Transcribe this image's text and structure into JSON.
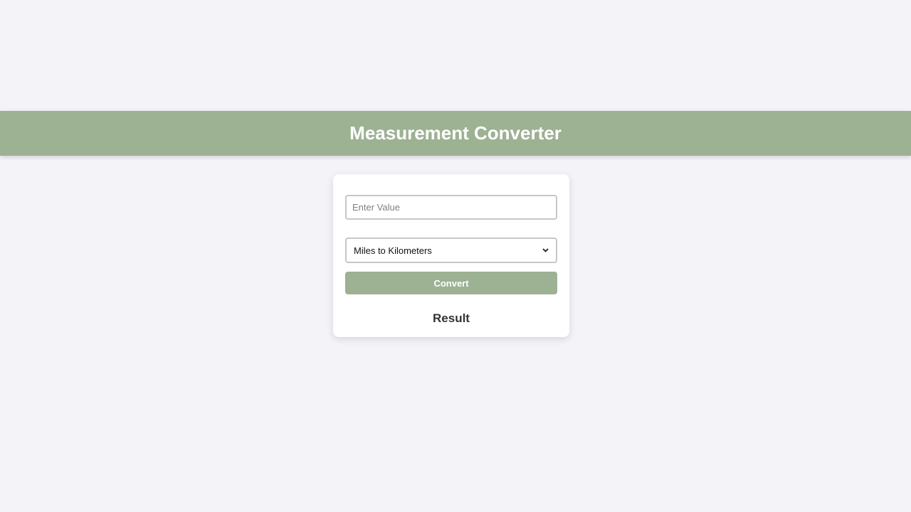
{
  "header": {
    "title": "Measurement Converter"
  },
  "form": {
    "value_placeholder": "Enter Value",
    "value": "",
    "conversion_selected": "Miles to Kilometers",
    "convert_label": "Convert"
  },
  "result": {
    "label": "Result"
  },
  "colors": {
    "accent": "#9db193",
    "background": "#f3f3f8"
  },
  "icons": {
    "select_chevron": "chevron-down-icon"
  }
}
